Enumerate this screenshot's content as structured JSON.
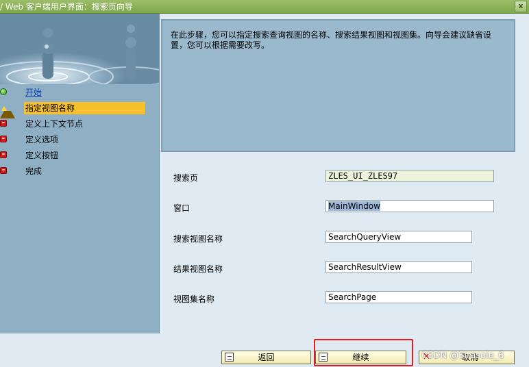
{
  "window": {
    "title": "/ Web 客户端用户界面：搜索页向导",
    "close_glyph": "x"
  },
  "steps": [
    {
      "label": "开始",
      "status": "done",
      "icon": "green-circle-icon",
      "link": true
    },
    {
      "label": "指定视图名称",
      "status": "current",
      "icon": "warning-triangle-icon"
    },
    {
      "label": "定义上下文节点",
      "status": "pending",
      "icon": "red-square-icon"
    },
    {
      "label": "定义选项",
      "status": "pending",
      "icon": "red-square-icon"
    },
    {
      "label": "定义按钮",
      "status": "pending",
      "icon": "red-square-icon"
    },
    {
      "label": "完成",
      "status": "pending",
      "icon": "red-square-icon"
    }
  ],
  "description": "在此步骤，您可以指定搜索查询视图的名称、搜索结果视图和视图集。向导会建议缺省设置，您可以根据需要改写。",
  "form": {
    "search_page_label": "搜索页",
    "search_page_value": "ZLES_UI_ZLES97",
    "window_label": "窗口",
    "window_value": "MainWindow",
    "query_view_label": "搜索视图名称",
    "query_view_value": "SearchQueryView",
    "result_view_label": "结果视图名称",
    "result_view_value": "SearchResultView",
    "viewset_label": "视图集名称",
    "viewset_value": "SearchPage"
  },
  "buttons": {
    "back": "返回",
    "continue": "继续",
    "cancel": "取消"
  },
  "watermark": "CSDN @Sirasole_6",
  "colors": {
    "title_bar": "#8fb45e",
    "current_step": "#f6c12d",
    "highlight": "#e51c1c"
  }
}
